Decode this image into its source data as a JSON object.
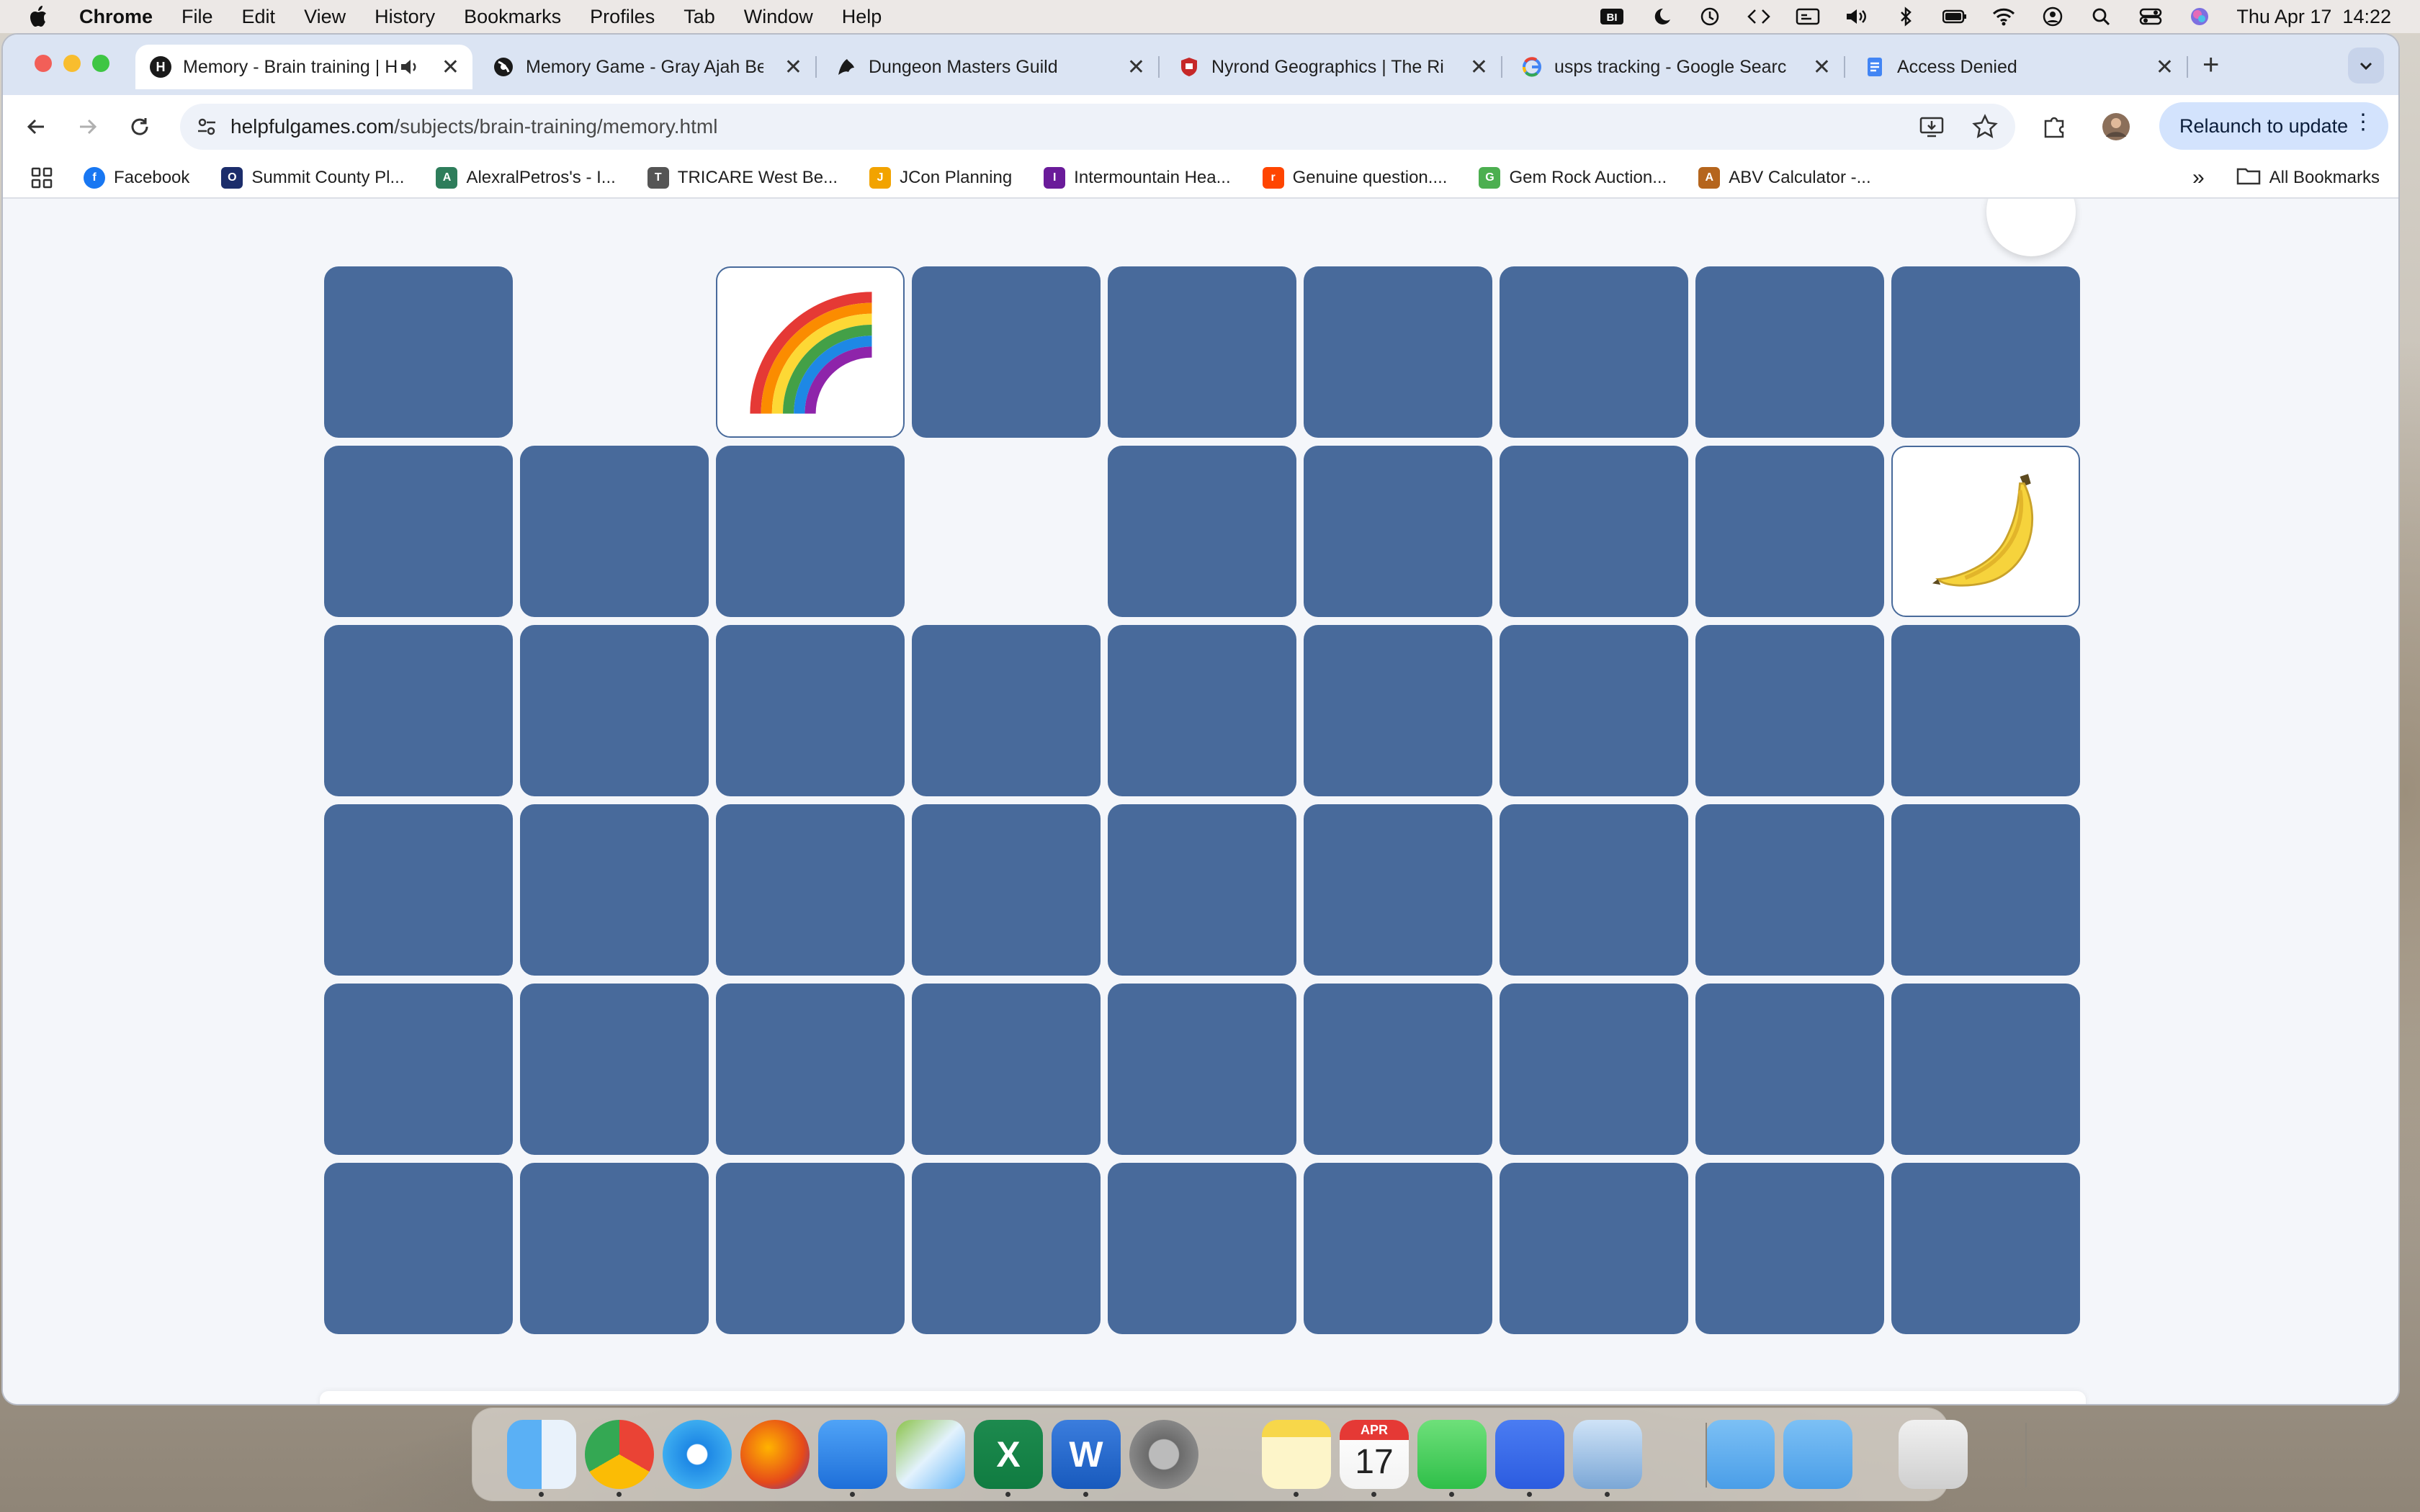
{
  "menubar": {
    "app": "Chrome",
    "items": [
      "File",
      "Edit",
      "View",
      "History",
      "Bookmarks",
      "Profiles",
      "Tab",
      "Window",
      "Help"
    ],
    "datetime": "Thu Apr 17  14:22",
    "icons": [
      "bi-icon",
      "moon-icon",
      "time-machine-icon",
      "code-icon",
      "caption-icon",
      "volume-icon",
      "bluetooth-icon",
      "battery-icon",
      "wifi-icon",
      "user-icon",
      "search-icon",
      "control-center-icon",
      "siri-icon"
    ]
  },
  "tabs": [
    {
      "title": "Memory - Brain training | H",
      "favicon": "H",
      "active": true,
      "icon": "speaker-icon"
    },
    {
      "title": "Memory Game - Gray Ajah Be",
      "favicon": "wheel"
    },
    {
      "title": "Dungeon Masters Guild",
      "favicon": "dmg"
    },
    {
      "title": "Nyrond Geographics | The Ri",
      "favicon": "shield"
    },
    {
      "title": "usps tracking - Google Searc",
      "favicon": "G"
    },
    {
      "title": "Access Denied",
      "favicon": "doc"
    }
  ],
  "toolbar": {
    "url_host": "helpfulgames.com",
    "url_path": "/subjects/brain-training/memory.html",
    "relaunch_label": "Relaunch to update"
  },
  "bookmarks": {
    "items": [
      {
        "label": "Facebook",
        "color": "#1877f2",
        "glyph": "f"
      },
      {
        "label": "Summit County Pl...",
        "color": "#1b2d6b",
        "glyph": "O"
      },
      {
        "label": "AlexralPetros's - I...",
        "color": "#2e7d5b",
        "glyph": "A"
      },
      {
        "label": "TRICARE West Be...",
        "color": "#555555",
        "glyph": "T"
      },
      {
        "label": "JCon Planning",
        "color": "#f2a300",
        "glyph": "J"
      },
      {
        "label": "Intermountain Hea...",
        "color": "#6a1b9a",
        "glyph": "I"
      },
      {
        "label": "Genuine question....",
        "color": "#ff4500",
        "glyph": "r"
      },
      {
        "label": "Gem Rock Auction...",
        "color": "#4caf50",
        "glyph": "G"
      },
      {
        "label": "ABV Calculator -...",
        "color": "#b5651d",
        "glyph": "A"
      }
    ],
    "all_label": "All Bookmarks"
  },
  "game": {
    "rows": [
      [
        "hidden",
        "empty",
        "rainbow",
        "hidden",
        "hidden",
        "hidden",
        "hidden",
        "hidden",
        "hidden"
      ],
      [
        "hidden",
        "hidden",
        "hidden",
        "empty",
        "hidden",
        "hidden",
        "hidden",
        "hidden",
        "banana"
      ],
      [
        "hidden",
        "hidden",
        "hidden",
        "hidden",
        "hidden",
        "hidden",
        "hidden",
        "hidden",
        "hidden"
      ],
      [
        "hidden",
        "hidden",
        "hidden",
        "hidden",
        "hidden",
        "hidden",
        "hidden",
        "hidden",
        "hidden"
      ],
      [
        "hidden",
        "hidden",
        "hidden",
        "hidden",
        "hidden",
        "hidden",
        "hidden",
        "hidden",
        "hidden"
      ],
      [
        "hidden",
        "hidden",
        "hidden",
        "hidden",
        "hidden",
        "hidden",
        "hidden",
        "hidden",
        "hidden"
      ]
    ],
    "card_back_color": "#486a9b"
  },
  "dock": {
    "apps": [
      "finder-icon",
      "chrome-icon",
      "safari-icon",
      "firefox-icon",
      "mail-icon",
      "maps-icon",
      "excel-icon",
      "word-icon",
      "settings-icon",
      "notes-icon",
      "calendar-icon",
      "messages-icon",
      "signal-icon",
      "preview-icon",
      "applications-folder-icon",
      "downloads-folder-icon",
      "trash-icon"
    ],
    "calendar_month": "APR",
    "calendar_day": "17"
  }
}
